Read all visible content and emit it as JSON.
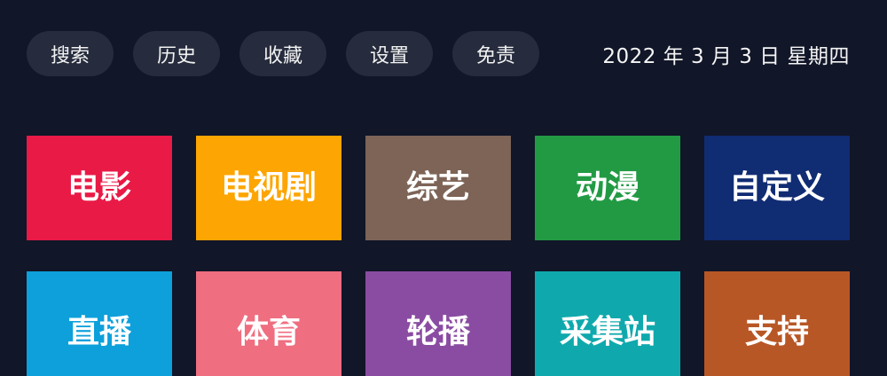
{
  "nav": {
    "buttons": [
      {
        "label": "搜索"
      },
      {
        "label": "历史"
      },
      {
        "label": "收藏"
      },
      {
        "label": "设置"
      },
      {
        "label": "免责"
      }
    ]
  },
  "date": "2022 年 3 月 3 日 星期四",
  "tiles": [
    {
      "label": "电影",
      "color": "#e91a46"
    },
    {
      "label": "电视剧",
      "color": "#fda502"
    },
    {
      "label": "综艺",
      "color": "#7d6457"
    },
    {
      "label": "动漫",
      "color": "#229a44"
    },
    {
      "label": "自定义",
      "color": "#102c73"
    },
    {
      "label": "直播",
      "color": "#0da0db"
    },
    {
      "label": "体育",
      "color": "#ef6e80"
    },
    {
      "label": "轮播",
      "color": "#8a4ca2"
    },
    {
      "label": "采集站",
      "color": "#0fa9ad"
    },
    {
      "label": "支持",
      "color": "#b85726"
    }
  ]
}
